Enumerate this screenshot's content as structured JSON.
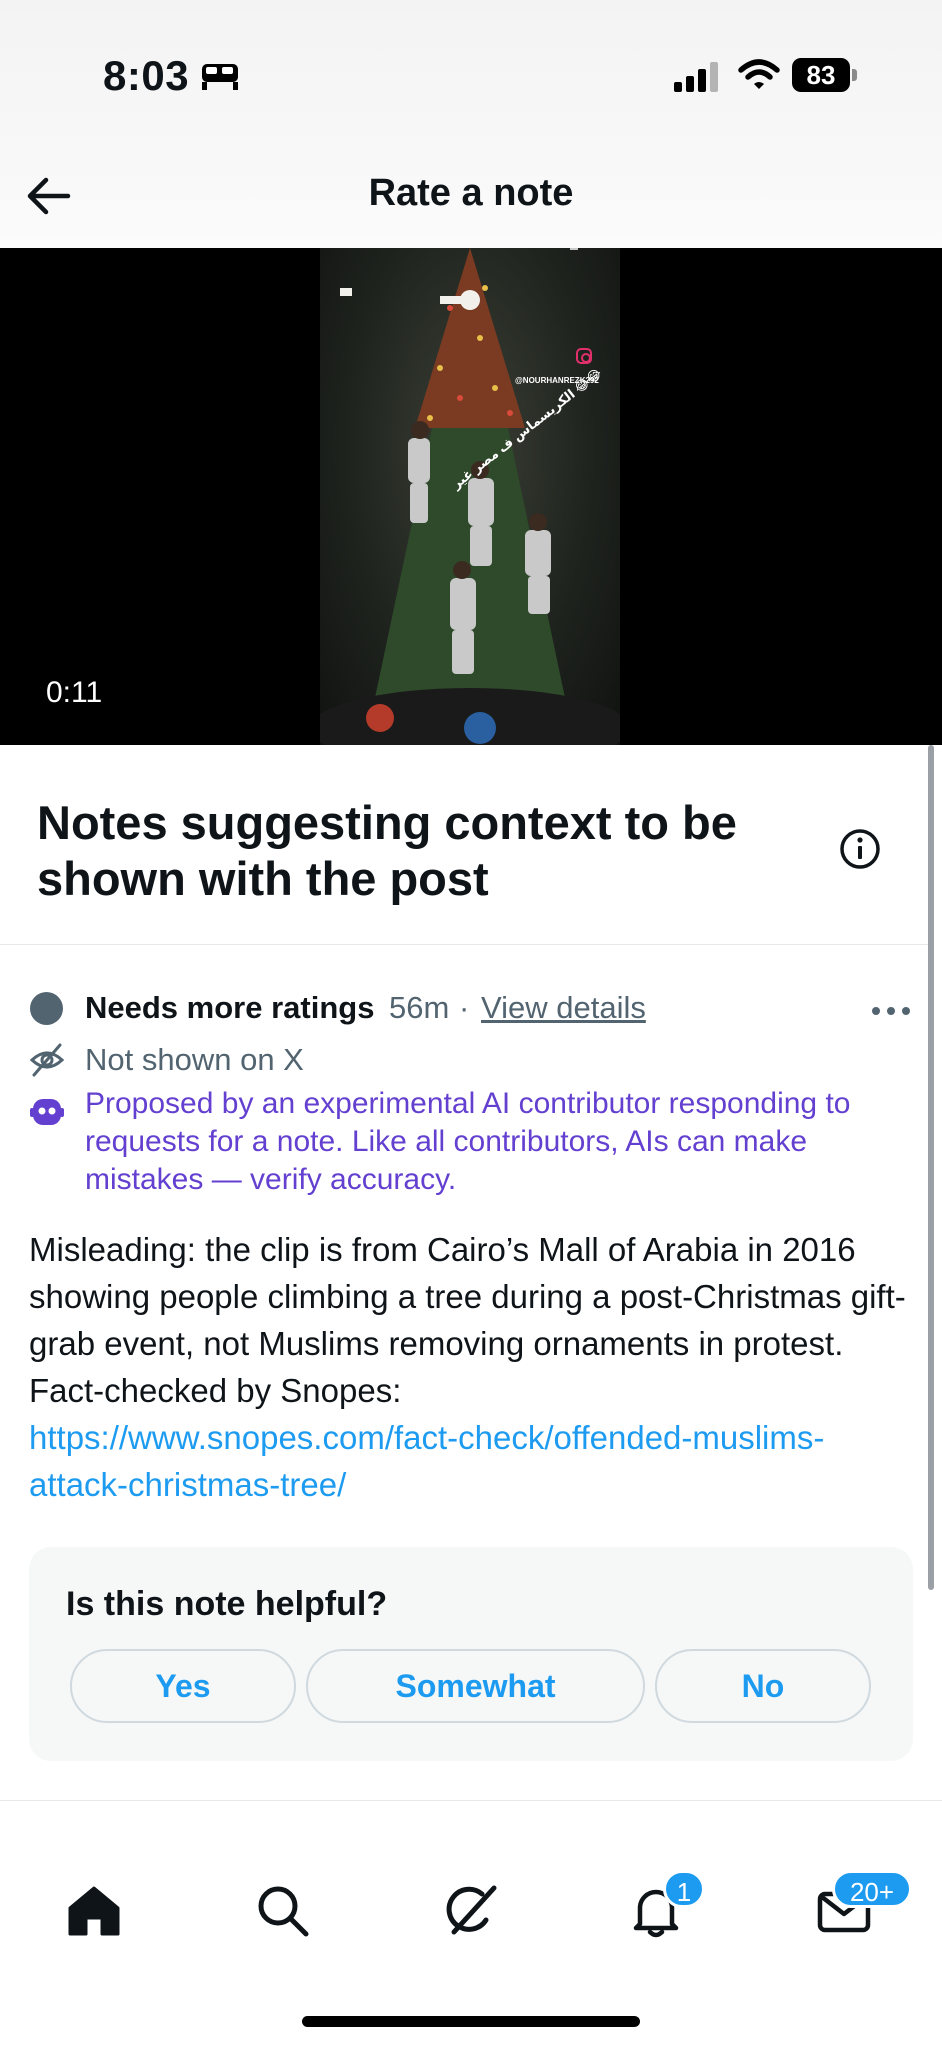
{
  "status_bar": {
    "time": "8:03",
    "battery": "83",
    "icons": [
      "bed-icon",
      "signal-icon",
      "wifi-icon",
      "battery-icon"
    ]
  },
  "header": {
    "title": "Rate a note",
    "back_icon": "back-arrow-icon"
  },
  "video": {
    "duration": "0:11",
    "overlay_text": "الكريسماس ف مصر غير 😂😂",
    "handle": "@NOURHANREZK292"
  },
  "notes_section": {
    "title": "Notes suggesting context to be shown with the post",
    "info_icon": "info-icon"
  },
  "note": {
    "status": "Needs more ratings",
    "time_ago": "56m",
    "separator": "·",
    "view_details": "View details",
    "visibility": "Not shown on X",
    "ai_disclaimer": "Proposed by an experimental AI contributor responding to requests for a note. Like all contributors, AIs can make mistakes — verify accuracy.",
    "body": "Misleading: the clip is from Cairo’s Mall of Arabia in 2016 showing people climbing a tree during a post-Christmas gift-grab event, not Muslims removing ornaments in protest. Fact-checked by Snopes:",
    "link": "https://www.snopes.com/fact-check/offended-muslims-attack-christmas-tree/"
  },
  "rating": {
    "question": "Is this note helpful?",
    "options": [
      "Yes",
      "Somewhat",
      "No"
    ]
  },
  "tab_bar": {
    "items": [
      "home-icon",
      "search-icon",
      "grok-icon",
      "notifications-icon",
      "messages-icon"
    ],
    "notifications_badge": "1",
    "messages_badge": "20+"
  },
  "colors": {
    "accent": "#1d9bf0",
    "ai_purple": "#6340d0",
    "muted": "#536471"
  }
}
